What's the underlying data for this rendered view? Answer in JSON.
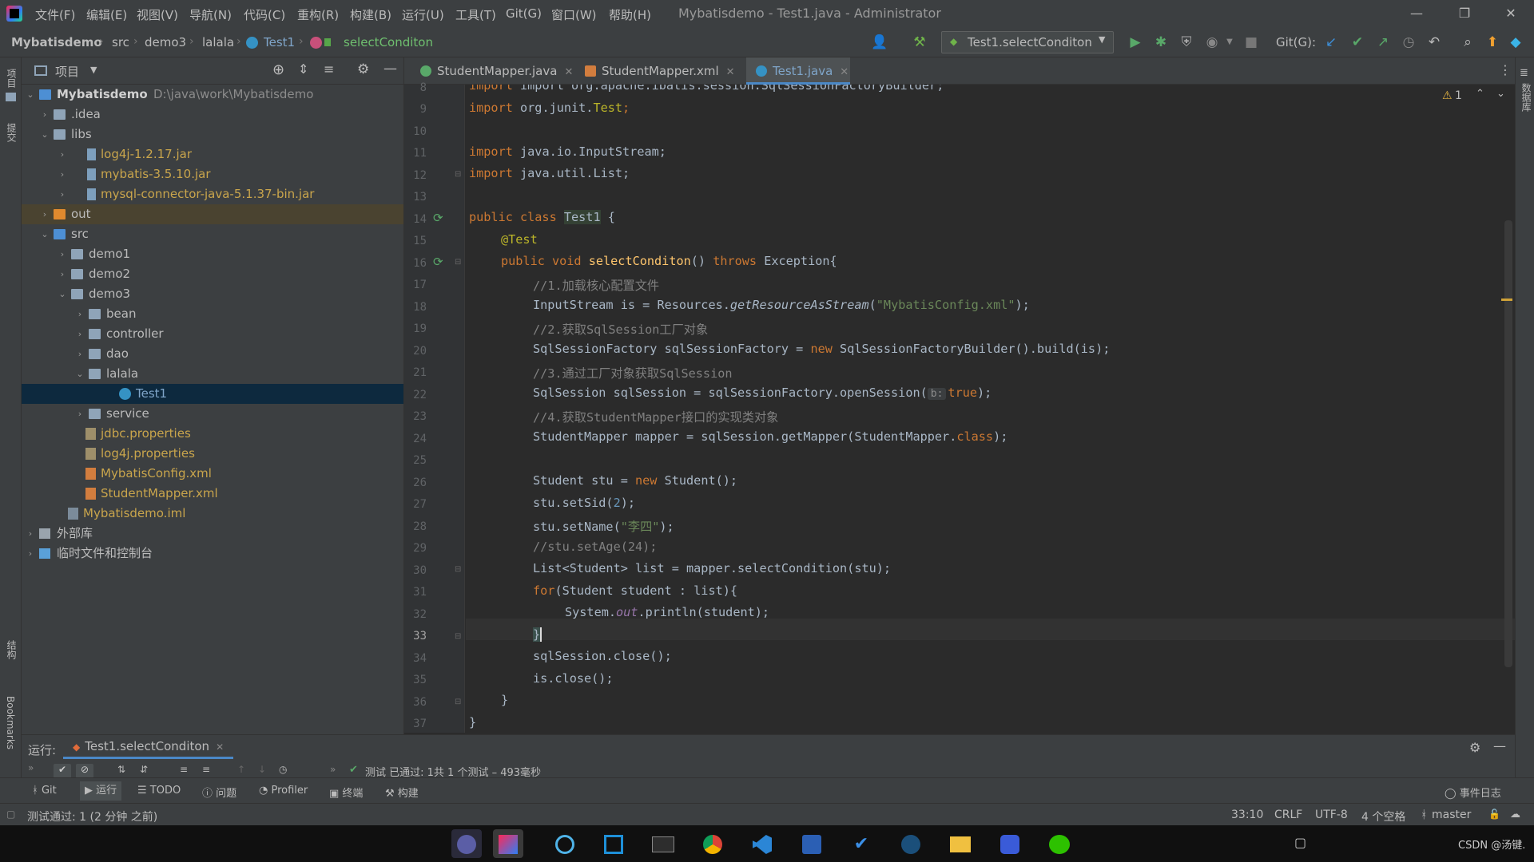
{
  "menubar": {
    "items": [
      "文件(F)",
      "编辑(E)",
      "视图(V)",
      "导航(N)",
      "代码(C)",
      "重构(R)",
      "构建(B)",
      "运行(U)",
      "工具(T)",
      "Git(G)",
      "窗口(W)",
      "帮助(H)"
    ],
    "title": "Mybatisdemo - Test1.java - Administrator"
  },
  "breadcrumb": {
    "items": [
      "Mybatisdemo",
      "src",
      "demo3",
      "lalala",
      "Test1",
      "selectConditon"
    ]
  },
  "toolbar": {
    "run_config": "Test1.selectConditon",
    "git_label": "Git(G):"
  },
  "project": {
    "title": "项目",
    "tree": [
      {
        "label": "Mybatisdemo",
        "path": "D:\\java\\work\\Mybatisdemo"
      },
      {
        "label": ".idea"
      },
      {
        "label": "libs"
      },
      {
        "label": "log4j-1.2.17.jar"
      },
      {
        "label": "mybatis-3.5.10.jar"
      },
      {
        "label": "mysql-connector-java-5.1.37-bin.jar"
      },
      {
        "label": "out"
      },
      {
        "label": "src"
      },
      {
        "label": "demo1"
      },
      {
        "label": "demo2"
      },
      {
        "label": "demo3"
      },
      {
        "label": "bean"
      },
      {
        "label": "controller"
      },
      {
        "label": "dao"
      },
      {
        "label": "lalala"
      },
      {
        "label": "Test1"
      },
      {
        "label": "service"
      },
      {
        "label": "jdbc.properties"
      },
      {
        "label": "log4j.properties"
      },
      {
        "label": "MybatisConfig.xml"
      },
      {
        "label": "StudentMapper.xml"
      },
      {
        "label": "Mybatisdemo.iml"
      },
      {
        "label": "外部库"
      },
      {
        "label": "临时文件和控制台"
      }
    ]
  },
  "tabs": [
    {
      "label": "StudentMapper.java"
    },
    {
      "label": "StudentMapper.xml"
    },
    {
      "label": "Test1.java"
    }
  ],
  "editor": {
    "warning_count": "1",
    "line_numbers": [
      "8",
      "9",
      "10",
      "11",
      "12",
      "13",
      "14",
      "15",
      "16",
      "17",
      "18",
      "19",
      "20",
      "21",
      "22",
      "23",
      "24",
      "25",
      "26",
      "27",
      "28",
      "29",
      "30",
      "31",
      "32",
      "33",
      "34",
      "35",
      "36",
      "37"
    ],
    "current_line": "33",
    "lines": {
      "l8": "import org.apache.ibatis.session.SqlSessionFactoryBuilder;",
      "l9a": "import ",
      "l9b": "org.junit.",
      "l9c": "Test",
      "l9d": ";",
      "l11a": "import ",
      "l11b": "java.io.InputStream;",
      "l12a": "import ",
      "l12b": "java.util.List;",
      "l14a": "public class ",
      "l14b": "Test1",
      "l14c": " {",
      "l15": "@Test",
      "l16a": "public void ",
      "l16b": "selectConditon",
      "l16c": "() ",
      "l16d": "throws",
      "l16e": " Exception{",
      "l17": "//1.加载核心配置文件",
      "l18a": "InputStream is = Resources.",
      "l18b": "getResourceAsStream",
      "l18c": "(",
      "l18d": "\"MybatisConfig.xml\"",
      "l18e": ");",
      "l19": "//2.获取SqlSession工厂对象",
      "l20a": "SqlSessionFactory sqlSessionFactory = ",
      "l20b": "new",
      "l20c": " SqlSessionFactoryBuilder().build(is);",
      "l21": "//3.通过工厂对象获取SqlSession",
      "l22a": "SqlSession sqlSession = sqlSessionFactory.openSession(",
      "l22h": "b:",
      "l22b": "true",
      "l22c": ");",
      "l23": "//4.获取StudentMapper接口的实现类对象",
      "l24a": "StudentMapper mapper = sqlSession.getMapper(StudentMapper.",
      "l24b": "class",
      "l24c": ");",
      "l26a": "Student stu = ",
      "l26b": "new",
      "l26c": " Student();",
      "l27a": "stu.setSid(",
      "l27b": "2",
      "l27c": ");",
      "l28a": "stu.setName(",
      "l28b": "\"李四\"",
      "l28c": ");",
      "l29": "//stu.setAge(24);",
      "l30": "List<Student> list = mapper.selectCondition(stu);",
      "l31a": "for",
      "l31b": "(Student student : list){",
      "l32a": "System.",
      "l32b": "out",
      "l32c": ".println(student);",
      "l33": "}",
      "l34": "sqlSession.close();",
      "l35": "is.close();",
      "l36": "}",
      "l37": "}"
    }
  },
  "run_panel": {
    "label": "运行:",
    "tab": "Test1.selectConditon",
    "result": "测试 已通过: 1共 1 个测试 – 493毫秒"
  },
  "bottom_tools": [
    "Git",
    "运行",
    "TODO",
    "问题",
    "Profiler",
    "终端",
    "构建"
  ],
  "event_log": "事件日志",
  "status": {
    "message": "测试通过: 1 (2 分钟 之前)",
    "position": "33:10",
    "line_sep": "CRLF",
    "encoding": "UTF-8",
    "indent": "4 个空格",
    "branch": "master"
  },
  "left_strip": [
    "项目",
    "提交",
    "结构",
    "Bookmarks"
  ],
  "right_strip": [
    "数据库"
  ],
  "taskbar": {
    "watermark": "CSDN @汤键."
  },
  "colors": {
    "keyword": "#cc7832",
    "string": "#6a8759",
    "comment": "#808080",
    "annotation": "#bbb529",
    "method": "#ffc66d",
    "field": "#9876aa",
    "selection": "#0d293e",
    "accent": "#4a88c7"
  }
}
